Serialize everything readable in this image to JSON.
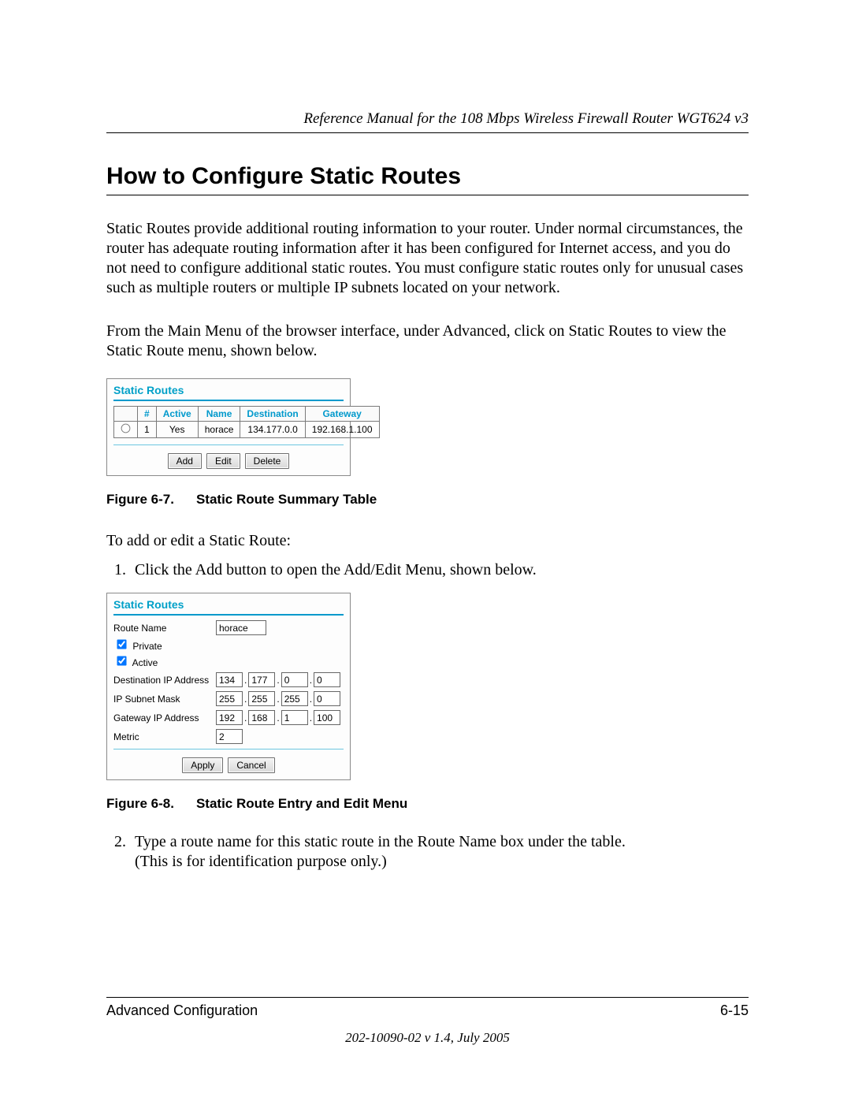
{
  "header": {
    "running": "Reference Manual for the 108 Mbps Wireless Firewall Router WGT624 v3"
  },
  "section": {
    "title": "How to Configure Static Routes"
  },
  "para1": "Static Routes provide additional routing information to your router. Under normal circumstances, the router has adequate routing information after it has been configured for Internet access, and you do not need to configure additional static routes. You must configure static routes only for unusual cases such as multiple routers or multiple IP subnets located on your network.",
  "para2": "From the Main Menu of the browser interface, under Advanced, click on Static Routes to view the Static Route menu, shown below.",
  "fig7": {
    "panel_title": "Static Routes",
    "columns": {
      "num": "#",
      "active": "Active",
      "name": "Name",
      "dest": "Destination",
      "gw": "Gateway"
    },
    "row": {
      "num": "1",
      "active": "Yes",
      "name": "horace",
      "dest": "134.177.0.0",
      "gw": "192.168.1.100"
    },
    "buttons": {
      "add": "Add",
      "edit": "Edit",
      "delete": "Delete"
    },
    "caption_label": "Figure 6-7.",
    "caption_text": "Static Route Summary Table"
  },
  "lead": "To add or edit a Static Route:",
  "step1": "Click the Add button to open the Add/Edit Menu, shown below.",
  "fig8": {
    "panel_title": "Static Routes",
    "labels": {
      "route_name": "Route Name",
      "private": "Private",
      "active": "Active",
      "dest": "Destination IP Address",
      "mask": "IP Subnet Mask",
      "gw": "Gateway IP Address",
      "metric": "Metric"
    },
    "values": {
      "route_name": "horace",
      "private_checked": true,
      "active_checked": true,
      "dest": [
        "134",
        "177",
        "0",
        "0"
      ],
      "mask": [
        "255",
        "255",
        "255",
        "0"
      ],
      "gw": [
        "192",
        "168",
        "1",
        "100"
      ],
      "metric": "2"
    },
    "buttons": {
      "apply": "Apply",
      "cancel": "Cancel"
    },
    "caption_label": "Figure 6-8.",
    "caption_text": "Static Route Entry and Edit Menu"
  },
  "step2a": "Type a route name for this static route in the Route Name box under the table.",
  "step2b": "(This is for identification purpose only.)",
  "footer": {
    "left": "Advanced Configuration",
    "right": "6-15",
    "docver": "202-10090-02 v 1.4, July 2005"
  }
}
